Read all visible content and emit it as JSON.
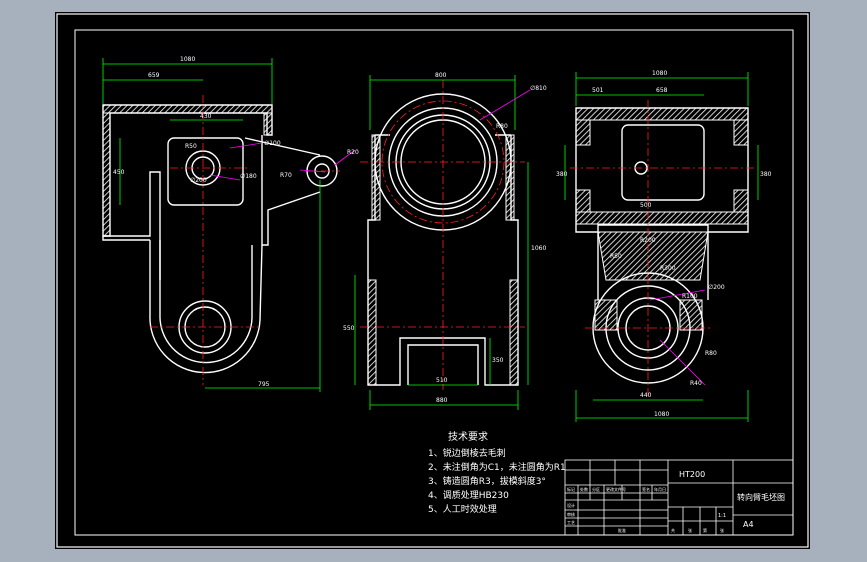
{
  "colors": {
    "background": "#a7b0bd",
    "paper": "#000000",
    "outline": "#ffffff",
    "centerline": "#ff2020",
    "dimension": "#00ff00",
    "leader": "#ff00ff",
    "hatch": "#ffffff"
  },
  "left_view": {
    "dims": {
      "overall_width": "1080",
      "left_offset": "659",
      "inner_width": "430",
      "bottom_width": "795",
      "height": "450"
    },
    "notes": {
      "r1": "R50",
      "r2": "∅100",
      "r3": "∅180",
      "r4": "R70",
      "r5": "R20",
      "r6": "∅200"
    }
  },
  "middle_view": {
    "dims": {
      "top_width": "800",
      "diameter": "∅810",
      "bottom_width": "880",
      "slot_width": "510",
      "height_right": "1060",
      "height_left": "550",
      "height_small": "350"
    },
    "notes": {
      "diag": "R80"
    }
  },
  "right_view": {
    "dims": {
      "overall_width": "1080",
      "left_part": "501",
      "right_part": "658",
      "height_left": "380",
      "height_right": "380",
      "inner_width": "500",
      "bottom_width": "440",
      "bottom_overall": "1080"
    },
    "notes": {
      "a": "R200",
      "b": "R50",
      "c": "R300",
      "d": "R100",
      "e": "∅200",
      "f": "R80",
      "g": "R40"
    }
  },
  "tech_requirements": {
    "title": "技术要求",
    "items": [
      "1、锐边倒棱去毛刺",
      "2、未注倒角为C1，未注圆角为R1",
      "3、铸造圆角R3，拔模斜度3°",
      "4、调质处理HB230",
      "5、人工时效处理"
    ]
  },
  "title_block": {
    "material": "HT200",
    "drawing_name": "转向臂毛坯图",
    "sheet_size": "A4",
    "scale": "1:1",
    "row_labels": [
      "标记",
      "设计",
      "审核",
      "工艺"
    ],
    "sign_labels": [
      "处数",
      "分区",
      "更改文件号",
      "签名",
      "年月日"
    ],
    "bottom_labels": [
      "共",
      "张",
      "第",
      "张",
      "批准"
    ]
  }
}
